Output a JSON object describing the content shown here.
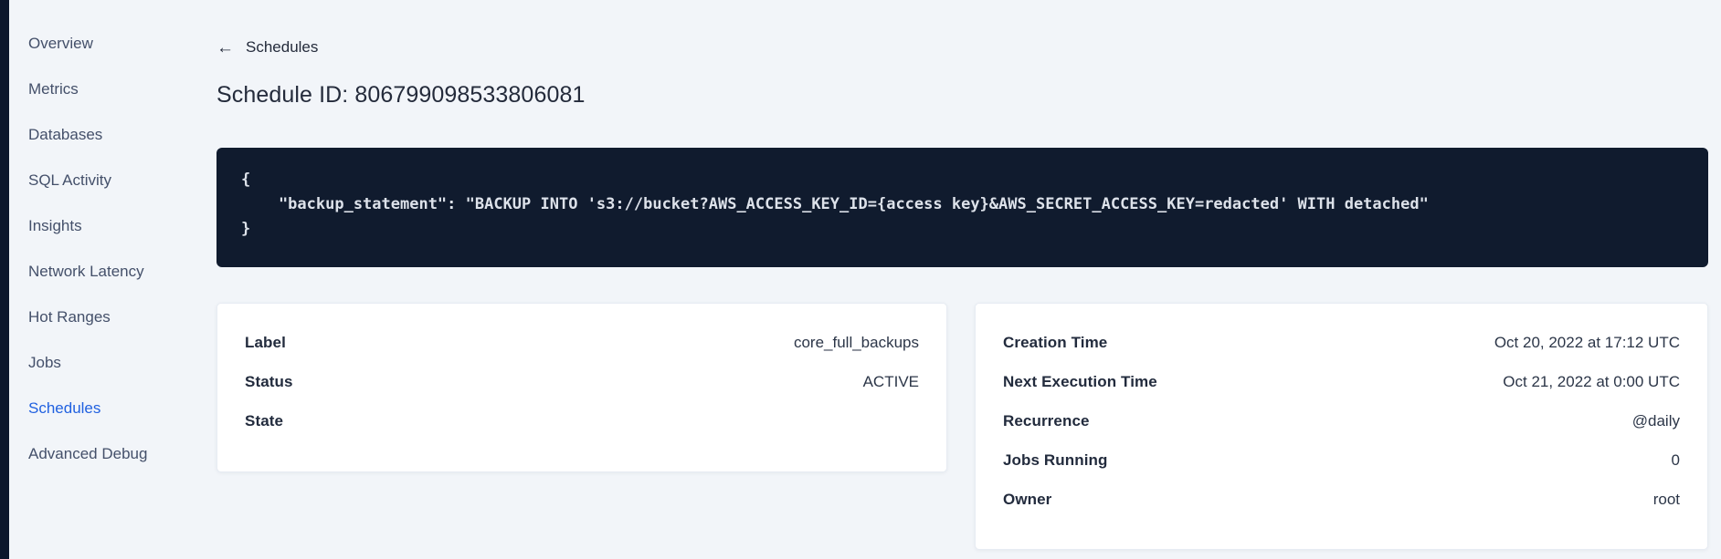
{
  "colors": {
    "page_background": "#f2f5f9",
    "left_rail": "#0c172c",
    "code_block_background": "#101b2e",
    "code_block_text": "#dde2ea",
    "sidebar_text": "#44506a",
    "sidebar_active": "#2161e0",
    "heading_text": "#242b3b",
    "card_background": "#ffffff",
    "card_border": "#e7ecf3"
  },
  "sidebar": {
    "items": [
      {
        "label": "Overview",
        "active": false
      },
      {
        "label": "Metrics",
        "active": false
      },
      {
        "label": "Databases",
        "active": false
      },
      {
        "label": "SQL Activity",
        "active": false
      },
      {
        "label": "Insights",
        "active": false
      },
      {
        "label": "Network Latency",
        "active": false
      },
      {
        "label": "Hot Ranges",
        "active": false
      },
      {
        "label": "Jobs",
        "active": false
      },
      {
        "label": "Schedules",
        "active": true
      },
      {
        "label": "Advanced Debug",
        "active": false
      }
    ]
  },
  "header": {
    "back_arrow": "←",
    "back_label": "Schedules",
    "title": "Schedule ID: 806799098533806081"
  },
  "code_block": {
    "lines": [
      "{",
      "    \"backup_statement\": \"BACKUP INTO 's3://bucket?AWS_ACCESS_KEY_ID={access key}&AWS_SECRET_ACCESS_KEY=redacted' WITH detached\"",
      "}"
    ]
  },
  "label_card": {
    "rows": [
      {
        "label": "Label",
        "value": "core_full_backups"
      },
      {
        "label": "Status",
        "value": "ACTIVE"
      },
      {
        "label": "State",
        "value": ""
      }
    ]
  },
  "meta_card": {
    "rows": [
      {
        "label": "Creation Time",
        "value": "Oct 20, 2022 at 17:12 UTC"
      },
      {
        "label": "Next Execution Time",
        "value": "Oct 21, 2022 at 0:00 UTC"
      },
      {
        "label": "Recurrence",
        "value": "@daily"
      },
      {
        "label": "Jobs Running",
        "value": "0"
      },
      {
        "label": "Owner",
        "value": "root"
      }
    ]
  }
}
